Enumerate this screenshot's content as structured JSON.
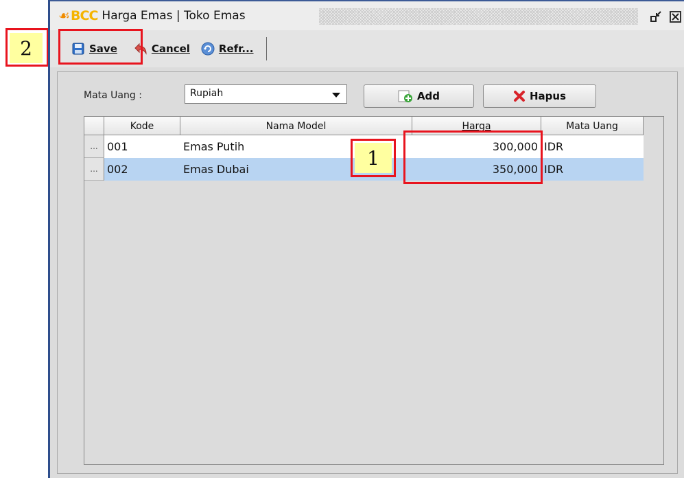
{
  "window": {
    "logo_text": "BCC",
    "title": "Harga Emas | Toko Emas"
  },
  "toolbar": {
    "save_label": "Save",
    "cancel_label": "Cancel",
    "refresh_label": "Refr..."
  },
  "filter": {
    "label": "Mata Uang :",
    "selected": "Rupiah"
  },
  "buttons": {
    "add_label": "Add",
    "hapus_label": "Hapus"
  },
  "table": {
    "columns": [
      "Kode",
      "Nama Model",
      "Harga",
      "Mata Uang"
    ],
    "rows": [
      {
        "indicator": "...",
        "kode": "001",
        "nama": "Emas Putih",
        "harga": "300,000",
        "mata_uang": "IDR"
      },
      {
        "indicator": "...",
        "kode": "002",
        "nama": "Emas Dubai",
        "harga": "350,000",
        "mata_uang": "IDR"
      }
    ]
  },
  "annotations": {
    "one": "1",
    "two": "2"
  },
  "colors": {
    "accent": "#e8141e",
    "selected_row": "#b8d4f2"
  }
}
